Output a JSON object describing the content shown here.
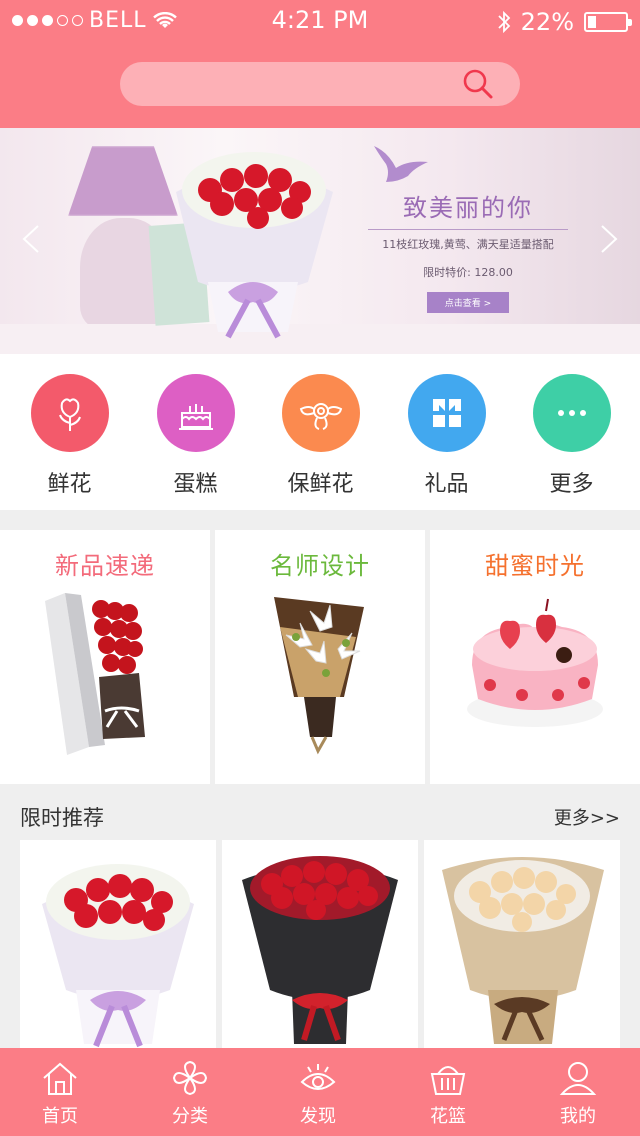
{
  "status_bar": {
    "carrier": "BELL",
    "time": "4:21 PM",
    "battery_text": "22%",
    "battery_level": 0.22,
    "signal_bars": 3,
    "signal_total": 5
  },
  "search": {
    "placeholder": ""
  },
  "banner": {
    "title": "致美丽的你",
    "subtitle": "11枝红玫瑰,黄莺、满天星适量搭配",
    "price": "限时特价: 128.00",
    "button": "点击查看 >"
  },
  "categories": [
    {
      "label": "鲜花",
      "color": "#f35a6b",
      "icon": "flower-icon"
    },
    {
      "label": "蛋糕",
      "color": "#dd5fc4",
      "icon": "cake-icon"
    },
    {
      "label": "保鲜花",
      "color": "#fb8a4f",
      "icon": "preserved-flower-icon"
    },
    {
      "label": "礼品",
      "color": "#42a8ef",
      "icon": "gift-icon"
    },
    {
      "label": "更多",
      "color": "#3ecfa6",
      "icon": "more-icon"
    }
  ],
  "features": [
    {
      "title": "新品速递",
      "color": "#f36b7b",
      "image": "gift-box-roses-image"
    },
    {
      "title": "名师设计",
      "color": "#6bb93c",
      "image": "lily-bouquet-image"
    },
    {
      "title": "甜蜜时光",
      "color": "#f5712e",
      "image": "heart-cake-image"
    }
  ],
  "recommend": {
    "title": "限时推荐",
    "more": "更多>>",
    "items": [
      {
        "image": "red-roses-white-wrap-image"
      },
      {
        "image": "red-roses-black-wrap-image"
      },
      {
        "image": "champagne-roses-kraft-wrap-image"
      }
    ]
  },
  "tabbar": [
    {
      "label": "首页",
      "icon": "home-icon"
    },
    {
      "label": "分类",
      "icon": "category-icon"
    },
    {
      "label": "发现",
      "icon": "discover-eye-icon"
    },
    {
      "label": "花篮",
      "icon": "basket-icon"
    },
    {
      "label": "我的",
      "icon": "user-icon"
    }
  ],
  "colors": {
    "brand": "#fb7d86",
    "search_bg": "#fdb0b6"
  }
}
